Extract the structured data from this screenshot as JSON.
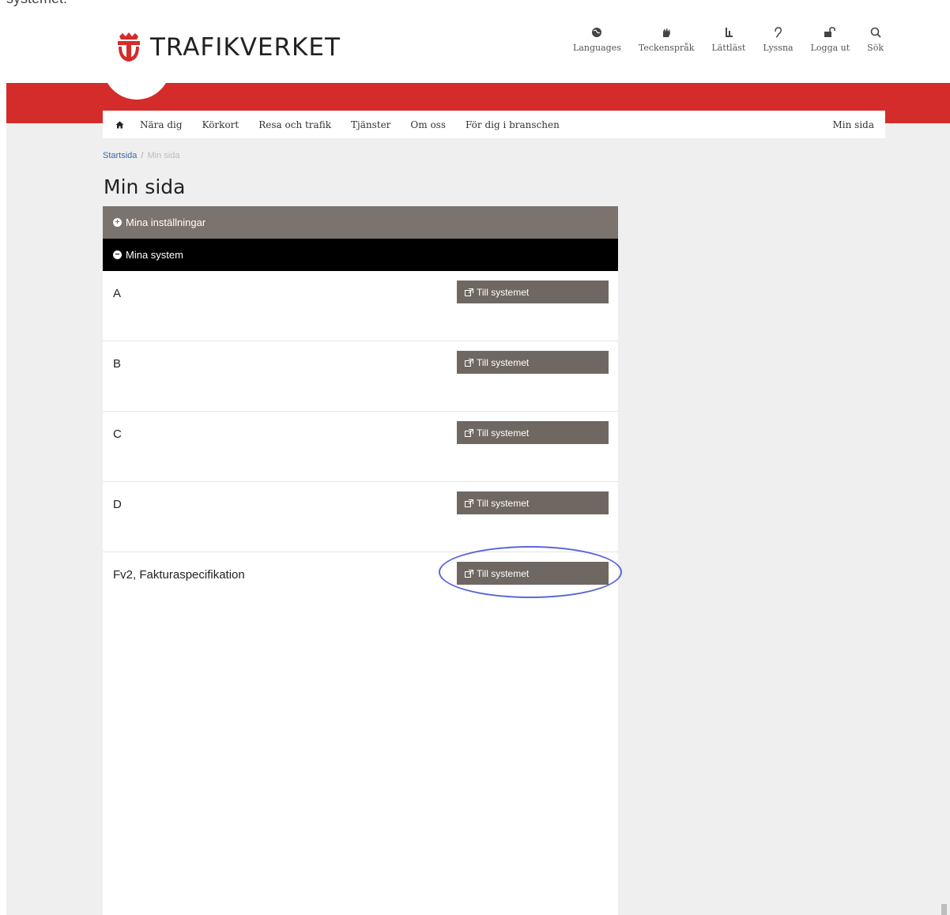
{
  "caption": "systemet.",
  "brand": {
    "name": "TRAFIKVERKET",
    "color": "#d42b2b"
  },
  "utility_nav": [
    {
      "label": "Languages",
      "icon": "globe-icon"
    },
    {
      "label": "Teckenspråk",
      "icon": "hand-sign-icon"
    },
    {
      "label": "Lättläst",
      "icon": "easy-read-icon"
    },
    {
      "label": "Lyssna",
      "icon": "ear-icon"
    },
    {
      "label": "Logga ut",
      "icon": "unlock-icon"
    },
    {
      "label": "Sök",
      "icon": "search-icon"
    }
  ],
  "main_nav": {
    "home_icon": "home-icon",
    "items": [
      "Nära dig",
      "Körkort",
      "Resa och trafik",
      "Tjänster",
      "Om oss",
      "För dig i branschen"
    ],
    "right": "Min sida"
  },
  "breadcrumb": {
    "home": "Startsida",
    "separator": "/",
    "current": "Min sida"
  },
  "page_title": "Min sida",
  "panels": {
    "settings": {
      "label": "Mina inställningar",
      "icon": "plus-circle-icon"
    },
    "systems": {
      "label": "Mina system",
      "icon": "minus-circle-icon"
    }
  },
  "systems": [
    {
      "name": "A",
      "button": "Till systemet"
    },
    {
      "name": "B",
      "button": "Till systemet"
    },
    {
      "name": "C",
      "button": "Till systemet"
    },
    {
      "name": "D",
      "button": "Till systemet"
    },
    {
      "name": "Fv2, Fakturaspecifikation",
      "button": "Till systemet",
      "highlighted": true
    }
  ],
  "colors": {
    "settings_bar": "#7b736e",
    "systems_bar": "#000000",
    "button": "#6f6862",
    "highlight": "#5b67d8"
  }
}
